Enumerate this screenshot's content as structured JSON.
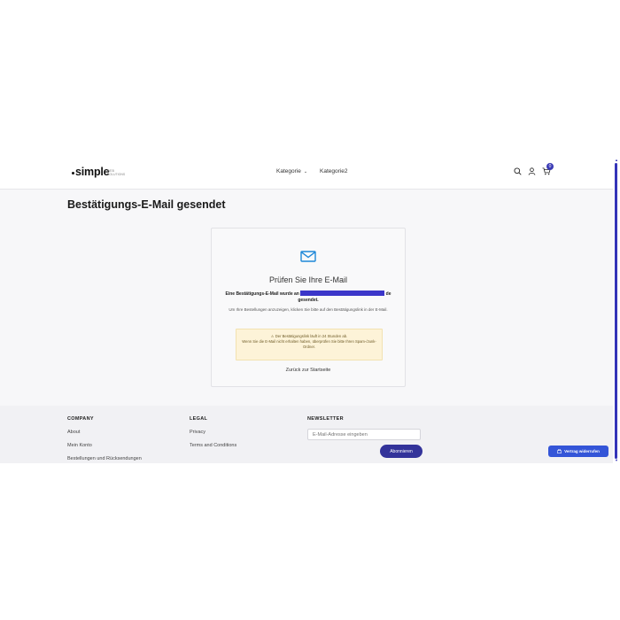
{
  "header": {
    "logo_text": "simple",
    "logo_sub": "WEB SOLUTIONS",
    "nav": [
      {
        "label": "Kategorie",
        "has_dropdown": true
      },
      {
        "label": "Kategorie2",
        "has_dropdown": false
      }
    ],
    "cart_count": "0",
    "icons": [
      "search-icon",
      "user-icon",
      "cart-icon"
    ]
  },
  "page": {
    "title": "Bestätigungs-E-Mail gesendet"
  },
  "card": {
    "icon": "mail-icon",
    "title": "Prüfen Sie Ihre E-Mail",
    "line1_prefix": "Eine Bestätigungs-E-Mail wurde an",
    "line1_suffix": "de",
    "line2": "gesendet.",
    "info": "Um Ihre Bestellungen anzuzeigen, klicken Sie bitte auf den Bestätigungslink in der E-Mail.",
    "notice_line1": "⚠ Der Bestätigungslink läuft in 24 Stunden ab.",
    "notice_line2": "Wenn Sie die E-Mail nicht erhalten haben, überprüfen Sie bitte Ihren Spam-/Junk-Ordner.",
    "back_link": "Zurück zur Startseite"
  },
  "footer": {
    "company": {
      "heading": "COMPANY",
      "links": [
        "About",
        "Mein Konto",
        "Bestellungen und Rücksendungen"
      ]
    },
    "legal": {
      "heading": "LEGAL",
      "links": [
        "Privacy",
        "Terms and Conditions"
      ]
    },
    "newsletter": {
      "heading": "NEWSLETTER",
      "placeholder": "E-Mail-Adresse eingeben",
      "button": "Abonnieren"
    }
  },
  "withdraw_button": "Vertrag widerrufen",
  "colors": {
    "accent": "#3434b8",
    "mail_icon": "#1e88d8",
    "notice_bg": "#fdf3d8",
    "withdraw_bg": "#3455d8"
  }
}
